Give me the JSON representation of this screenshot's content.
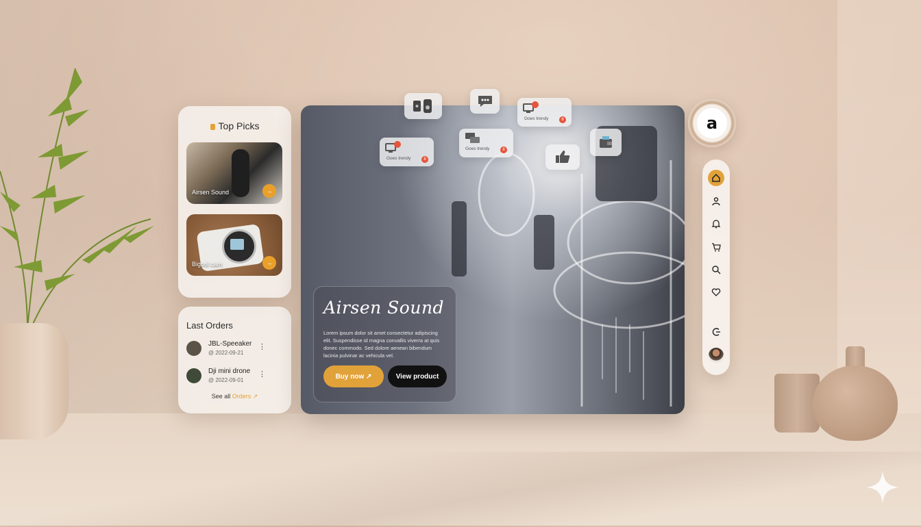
{
  "top_picks": {
    "title": "Top Picks",
    "items": [
      {
        "caption": "Airsen Sound",
        "badge": "→"
      },
      {
        "caption": "Bigool cam",
        "badge": "→"
      }
    ]
  },
  "last_orders": {
    "title": "Last Orders",
    "items": [
      {
        "name": "JBL-Speeaker",
        "date": "@ 2022-09-21",
        "more": "⋮"
      },
      {
        "name": "Dji mini drone",
        "date": "@ 2022-09-01",
        "more": "⋮"
      }
    ],
    "see_all": "See all",
    "see_all_accent": "Orders ↗"
  },
  "hero": {
    "title": "Airsen Sound",
    "body": "Lorem ipsum dolor sit amet consectetur adipiscing elit. Suspendisse id magna convallis viverra at quis donec commodo. Sed dolore aenean bibendum lacinia pulvinar ac vehicula vel.",
    "buy_label": "Buy now ↗",
    "view_label": "View product"
  },
  "floating": {
    "trending_label": "Goes trendy",
    "notif_count": "8"
  },
  "brand": {
    "logo_letter": "a"
  },
  "nav": {
    "items": [
      "home-icon",
      "user-icon",
      "bell-icon",
      "cart-icon",
      "search-icon",
      "heart-icon",
      "logout-icon"
    ],
    "active": "home-icon"
  },
  "colors": {
    "accent": "#e2a23a",
    "dark": "#111111",
    "notif": "#e4553b"
  }
}
